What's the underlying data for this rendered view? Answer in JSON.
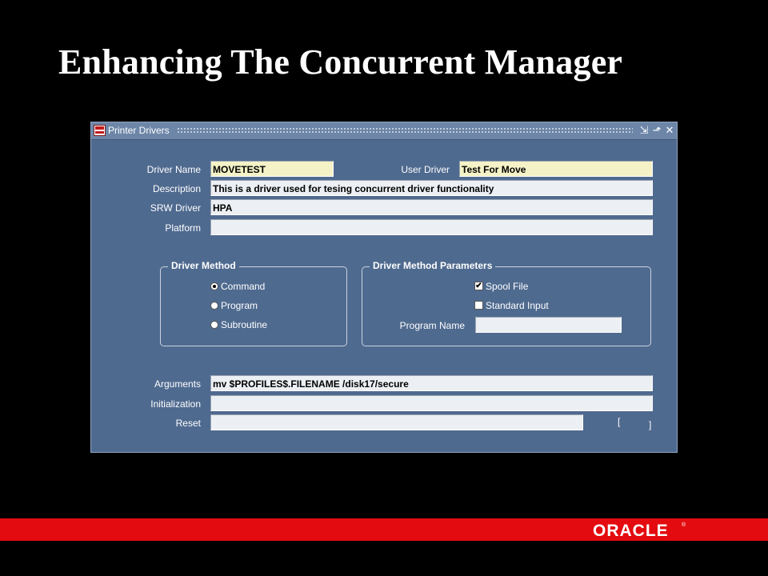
{
  "slide": {
    "title": "Enhancing The Concurrent Manager"
  },
  "window": {
    "title": "Printer Drivers",
    "controls": {
      "minimize": "⇲",
      "maximize": "⬏",
      "close": "✕"
    }
  },
  "fields": {
    "driver_name": {
      "label": "Driver Name",
      "value": "MOVETEST"
    },
    "user_driver": {
      "label": "User Driver",
      "value": "Test For Move"
    },
    "description": {
      "label": "Description",
      "value": "This is a driver used for tesing concurrent driver functionality"
    },
    "srw_driver": {
      "label": "SRW Driver",
      "value": "HPA"
    },
    "platform": {
      "label": "Platform",
      "value": ""
    }
  },
  "driver_method": {
    "legend": "Driver Method",
    "options": [
      {
        "label": "Command",
        "selected": true
      },
      {
        "label": "Program",
        "selected": false
      },
      {
        "label": "Subroutine",
        "selected": false
      }
    ]
  },
  "driver_method_params": {
    "legend": "Driver Method Parameters",
    "spool_file": {
      "label": "Spool File",
      "checked": true,
      "mark": "✔"
    },
    "standard_input": {
      "label": "Standard Input",
      "checked": false,
      "mark": ""
    },
    "program_name": {
      "label": "Program Name",
      "value": ""
    }
  },
  "bottom_fields": {
    "arguments": {
      "label": "Arguments",
      "value": "mv $PROFILES$.FILENAME /disk17/secure"
    },
    "initialization": {
      "label": "Initialization",
      "value": ""
    },
    "reset": {
      "label": "Reset",
      "value": ""
    },
    "bracket_open": "[",
    "bracket_close": "]"
  },
  "footer": {
    "logo_text": "ORACLE",
    "registered": "®"
  },
  "colors": {
    "window_bg": "#4f6a8f",
    "required_field": "#f4f2c6",
    "footer_red": "#e30b0f"
  }
}
